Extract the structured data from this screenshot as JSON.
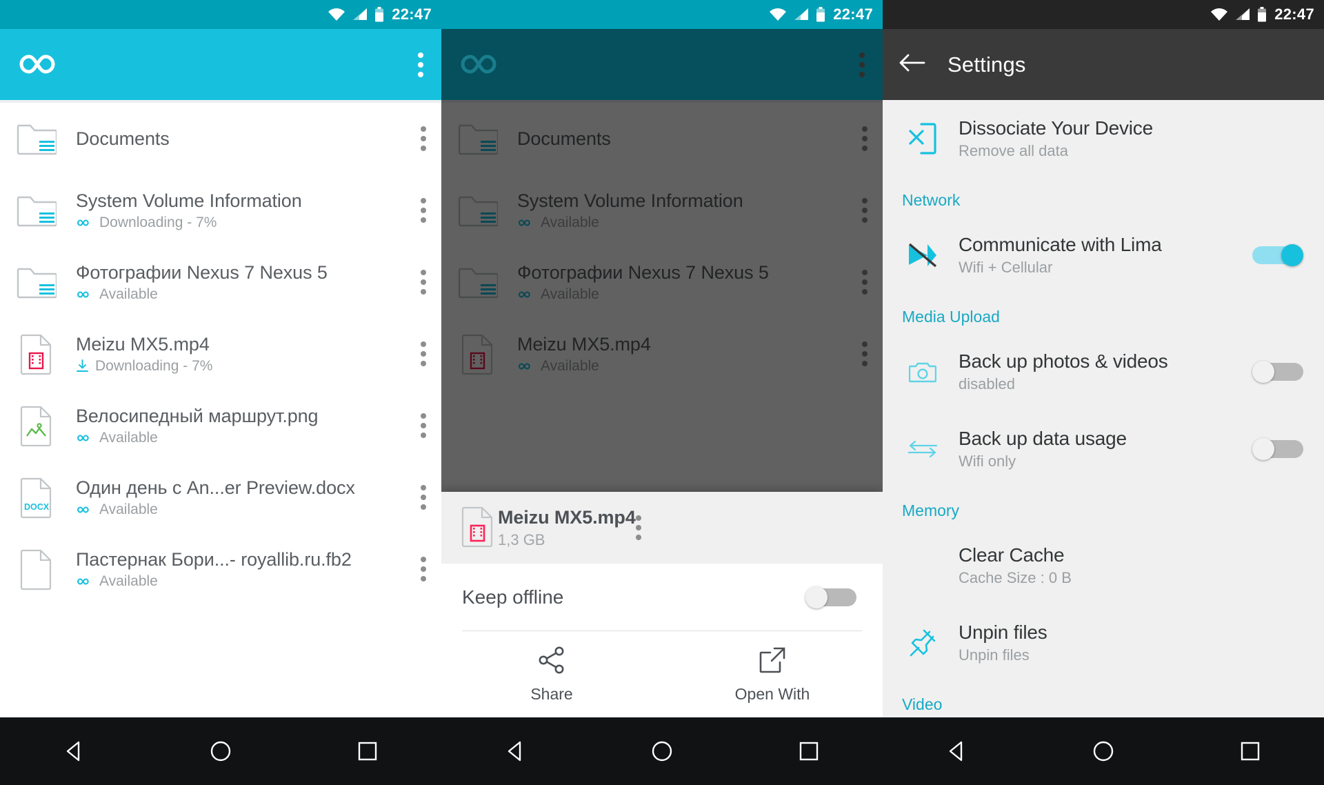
{
  "status_bar": {
    "time": "22:47",
    "icons": [
      "wifi-icon",
      "signal-icon",
      "battery-icon"
    ]
  },
  "colors": {
    "cyan": "#17c1de",
    "cyan_status": "#00a0b6",
    "teal_dark": "#05505c",
    "dark_bar": "#3a3a3a",
    "accent_header": "#17a9c4"
  },
  "panel1": {
    "appbar": {
      "logo": "infinity-logo",
      "overflow": "overflow-menu-icon"
    },
    "files": [
      {
        "name": "Documents",
        "status": "",
        "status_icon": "",
        "icon": "folder"
      },
      {
        "name": "System Volume Information",
        "status": "Downloading - 7%",
        "status_icon": "infinity",
        "icon": "folder"
      },
      {
        "name": "Фотографии Nexus 7 Nexus 5",
        "status": "Available",
        "status_icon": "infinity",
        "icon": "folder"
      },
      {
        "name": "Meizu MX5.mp4",
        "status": "Downloading - 7%",
        "status_icon": "download",
        "icon": "video"
      },
      {
        "name": "Велосипедный маршрут.png",
        "status": "Available",
        "status_icon": "infinity",
        "icon": "image"
      },
      {
        "name": "Один день с An...er Preview.docx",
        "status": "Available",
        "status_icon": "infinity",
        "icon": "docx"
      },
      {
        "name": "Пастернак Бори...- royallib.ru.fb2",
        "status": "Available",
        "status_icon": "infinity",
        "icon": "generic"
      }
    ]
  },
  "panel2": {
    "appbar": {
      "logo": "infinity-logo",
      "overflow": "overflow-menu-icon"
    },
    "files": [
      {
        "name": "Documents",
        "status": "",
        "status_icon": "",
        "icon": "folder"
      },
      {
        "name": "System Volume Information",
        "status": "Available",
        "status_icon": "infinity",
        "icon": "folder"
      },
      {
        "name": "Фотографии Nexus 7 Nexus 5",
        "status": "Available",
        "status_icon": "infinity",
        "icon": "folder"
      },
      {
        "name": "Meizu MX5.mp4",
        "status": "Available",
        "status_icon": "infinity",
        "icon": "video"
      }
    ],
    "sheet": {
      "file_name": "Meizu MX5.mp4",
      "file_size": "1,3 GB",
      "file_icon": "video",
      "keep_offline_label": "Keep offline",
      "keep_offline_state": "off",
      "actions": [
        {
          "label": "Share",
          "icon": "share-icon"
        },
        {
          "label": "Open With",
          "icon": "open-with-icon"
        }
      ]
    }
  },
  "panel3": {
    "appbar": {
      "back": "back-arrow-icon",
      "title": "Settings"
    },
    "items": [
      {
        "type": "item",
        "icon": "dissociate-device-icon",
        "title": "Dissociate Your Device",
        "subtitle": "Remove all data",
        "toggle": null
      },
      {
        "type": "header",
        "title": "Network"
      },
      {
        "type": "item",
        "icon": "communicate-icon",
        "title": "Communicate with Lima",
        "subtitle": "Wifi + Cellular",
        "toggle": "on"
      },
      {
        "type": "header",
        "title": "Media Upload"
      },
      {
        "type": "item",
        "icon": "camera-icon",
        "title": "Back up photos & videos",
        "subtitle": "disabled",
        "toggle": "off"
      },
      {
        "type": "item",
        "icon": "sync-arrows-icon",
        "title": "Back up data usage",
        "subtitle": "Wifi only",
        "toggle": "off"
      },
      {
        "type": "header",
        "title": "Memory"
      },
      {
        "type": "item-indent",
        "icon": "",
        "title": "Clear Cache",
        "subtitle": "Cache Size : 0 B",
        "toggle": null
      },
      {
        "type": "item",
        "icon": "pin-icon",
        "title": "Unpin files",
        "subtitle": "Unpin files",
        "toggle": null
      },
      {
        "type": "header",
        "title": "Video"
      }
    ]
  },
  "navbar": {
    "back": "nav-back-icon",
    "home": "nav-home-icon",
    "recents": "nav-recents-icon"
  }
}
